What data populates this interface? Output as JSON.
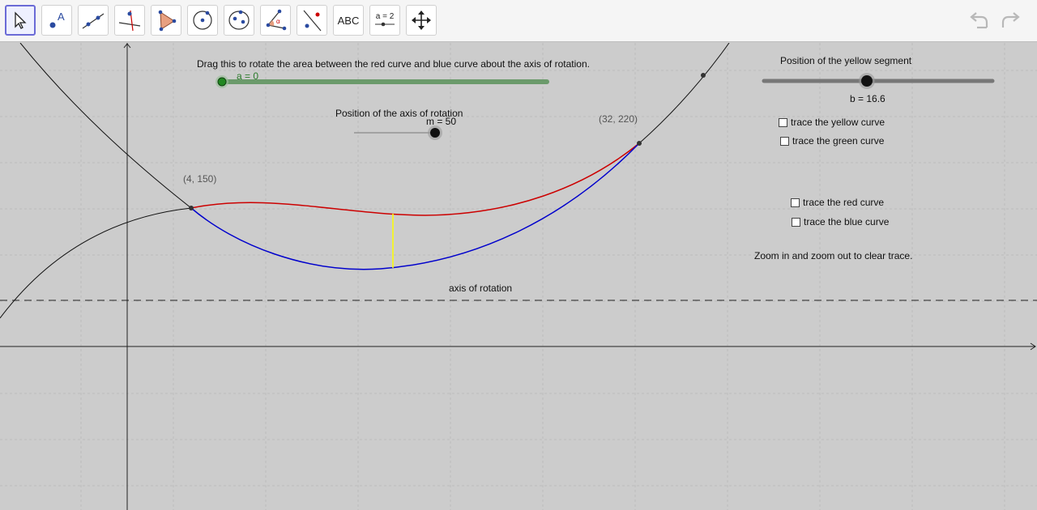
{
  "toolbar": {
    "tools": [
      {
        "name": "move-tool",
        "selected": true
      },
      {
        "name": "point-tool"
      },
      {
        "name": "line-tool"
      },
      {
        "name": "perpendicular-line-tool"
      },
      {
        "name": "polygon-tool"
      },
      {
        "name": "circle-center-tool"
      },
      {
        "name": "conic-tool"
      },
      {
        "name": "angle-tool"
      },
      {
        "name": "reflect-tool"
      },
      {
        "name": "text-tool",
        "label": "ABC"
      },
      {
        "name": "slider-tool",
        "label": "a = 2"
      },
      {
        "name": "move-graphics-view-tool"
      }
    ],
    "undo_icon": "undo-icon",
    "redo_icon": "redo-icon"
  },
  "sliders": {
    "rotate": {
      "caption": "Drag this to rotate the area between the red curve and blue curve about the axis of rotation.",
      "value_label": "a = 0",
      "value": 0
    },
    "axis": {
      "caption": "Position of the axis of rotation",
      "value_label": "m = 50",
      "value": 50
    },
    "yellow": {
      "caption": "Position of the yellow segment",
      "value_label": "b = 16.6",
      "value": 16.6
    }
  },
  "points": {
    "left": "(4, 150)",
    "right": "(32, 220)"
  },
  "checkboxes": [
    {
      "label": "trace the yellow curve",
      "checked": false
    },
    {
      "label": "trace the green curve",
      "checked": false
    },
    {
      "label": "trace the red curve",
      "checked": false
    },
    {
      "label": "trace the blue curve",
      "checked": false
    }
  ],
  "notes": {
    "zoom": "Zoom in and zoom out to clear trace.",
    "axis_label": "axis of rotation"
  },
  "colors": {
    "red_curve": "#cc0000",
    "blue_curve": "#0000cc",
    "yellow_segment": "#ffff00",
    "rotate_slider": "#6b9a6b",
    "rotate_knob": "#228822",
    "selected_tool": "#6b6bd6"
  }
}
